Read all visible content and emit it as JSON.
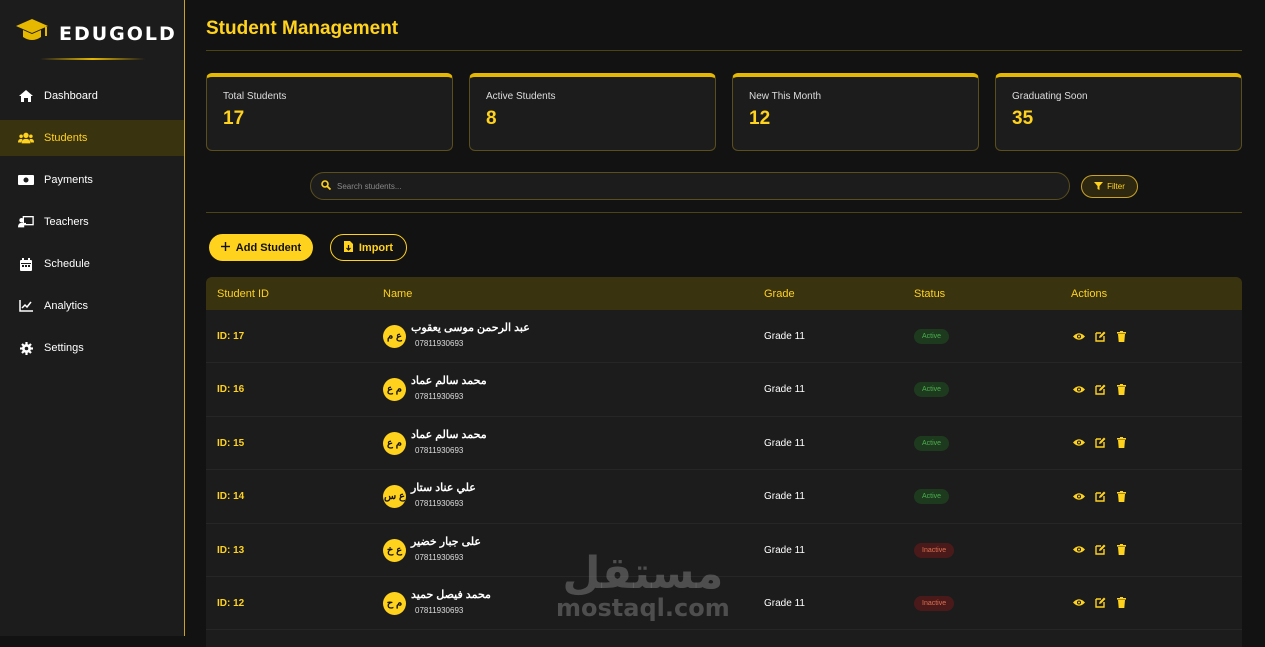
{
  "brand": {
    "name": "EDUGOLD"
  },
  "nav": [
    {
      "label": "Dashboard",
      "icon": "home-icon"
    },
    {
      "label": "Students",
      "icon": "users-icon",
      "active": true
    },
    {
      "label": "Payments",
      "icon": "money-icon"
    },
    {
      "label": "Teachers",
      "icon": "teacher-icon"
    },
    {
      "label": "Schedule",
      "icon": "calendar-icon"
    },
    {
      "label": "Analytics",
      "icon": "chart-line-icon"
    },
    {
      "label": "Settings",
      "icon": "gear-icon"
    }
  ],
  "page": {
    "title": "Student Management"
  },
  "stats": [
    {
      "label": "Total Students",
      "value": "17"
    },
    {
      "label": "Active Students",
      "value": "8"
    },
    {
      "label": "New This Month",
      "value": "12"
    },
    {
      "label": "Graduating Soon",
      "value": "35"
    }
  ],
  "search": {
    "placeholder": "Search students..."
  },
  "filter": {
    "label": "Filter"
  },
  "buttons": {
    "add": "Add Student",
    "import": "Import"
  },
  "table": {
    "columns": [
      "Student ID",
      "Name",
      "Grade",
      "Status",
      "Actions"
    ],
    "rows": [
      {
        "id": "ID: 17",
        "initials": "ع م",
        "name": "عبد الرحمن موسى يعقوب",
        "phone": "07811930693",
        "grade": "Grade 11",
        "status": "Active"
      },
      {
        "id": "ID: 16",
        "initials": "م ع",
        "name": "محمد سالم عماد",
        "phone": "07811930693",
        "grade": "Grade 11",
        "status": "Active"
      },
      {
        "id": "ID: 15",
        "initials": "م ع",
        "name": "محمد سالم عماد",
        "phone": "07811930693",
        "grade": "Grade 11",
        "status": "Active"
      },
      {
        "id": "ID: 14",
        "initials": "ع س",
        "name": "علي عناد ستار",
        "phone": "07811930693",
        "grade": "Grade 11",
        "status": "Active"
      },
      {
        "id": "ID: 13",
        "initials": "ع خ",
        "name": "على جبار خضير",
        "phone": "07811930693",
        "grade": "Grade 11",
        "status": "Inactive"
      },
      {
        "id": "ID: 12",
        "initials": "م ح",
        "name": "محمد فيصل حميد",
        "phone": "07811930693",
        "grade": "Grade 11",
        "status": "Inactive"
      }
    ]
  },
  "watermark": {
    "arabic": "مستقل",
    "latin": "mostaql.com"
  },
  "colors": {
    "accent": "#ffd21e",
    "background": "#121212",
    "panel": "#1c1c1c",
    "active_green": "#4caf50",
    "inactive_red": "#e07050"
  }
}
